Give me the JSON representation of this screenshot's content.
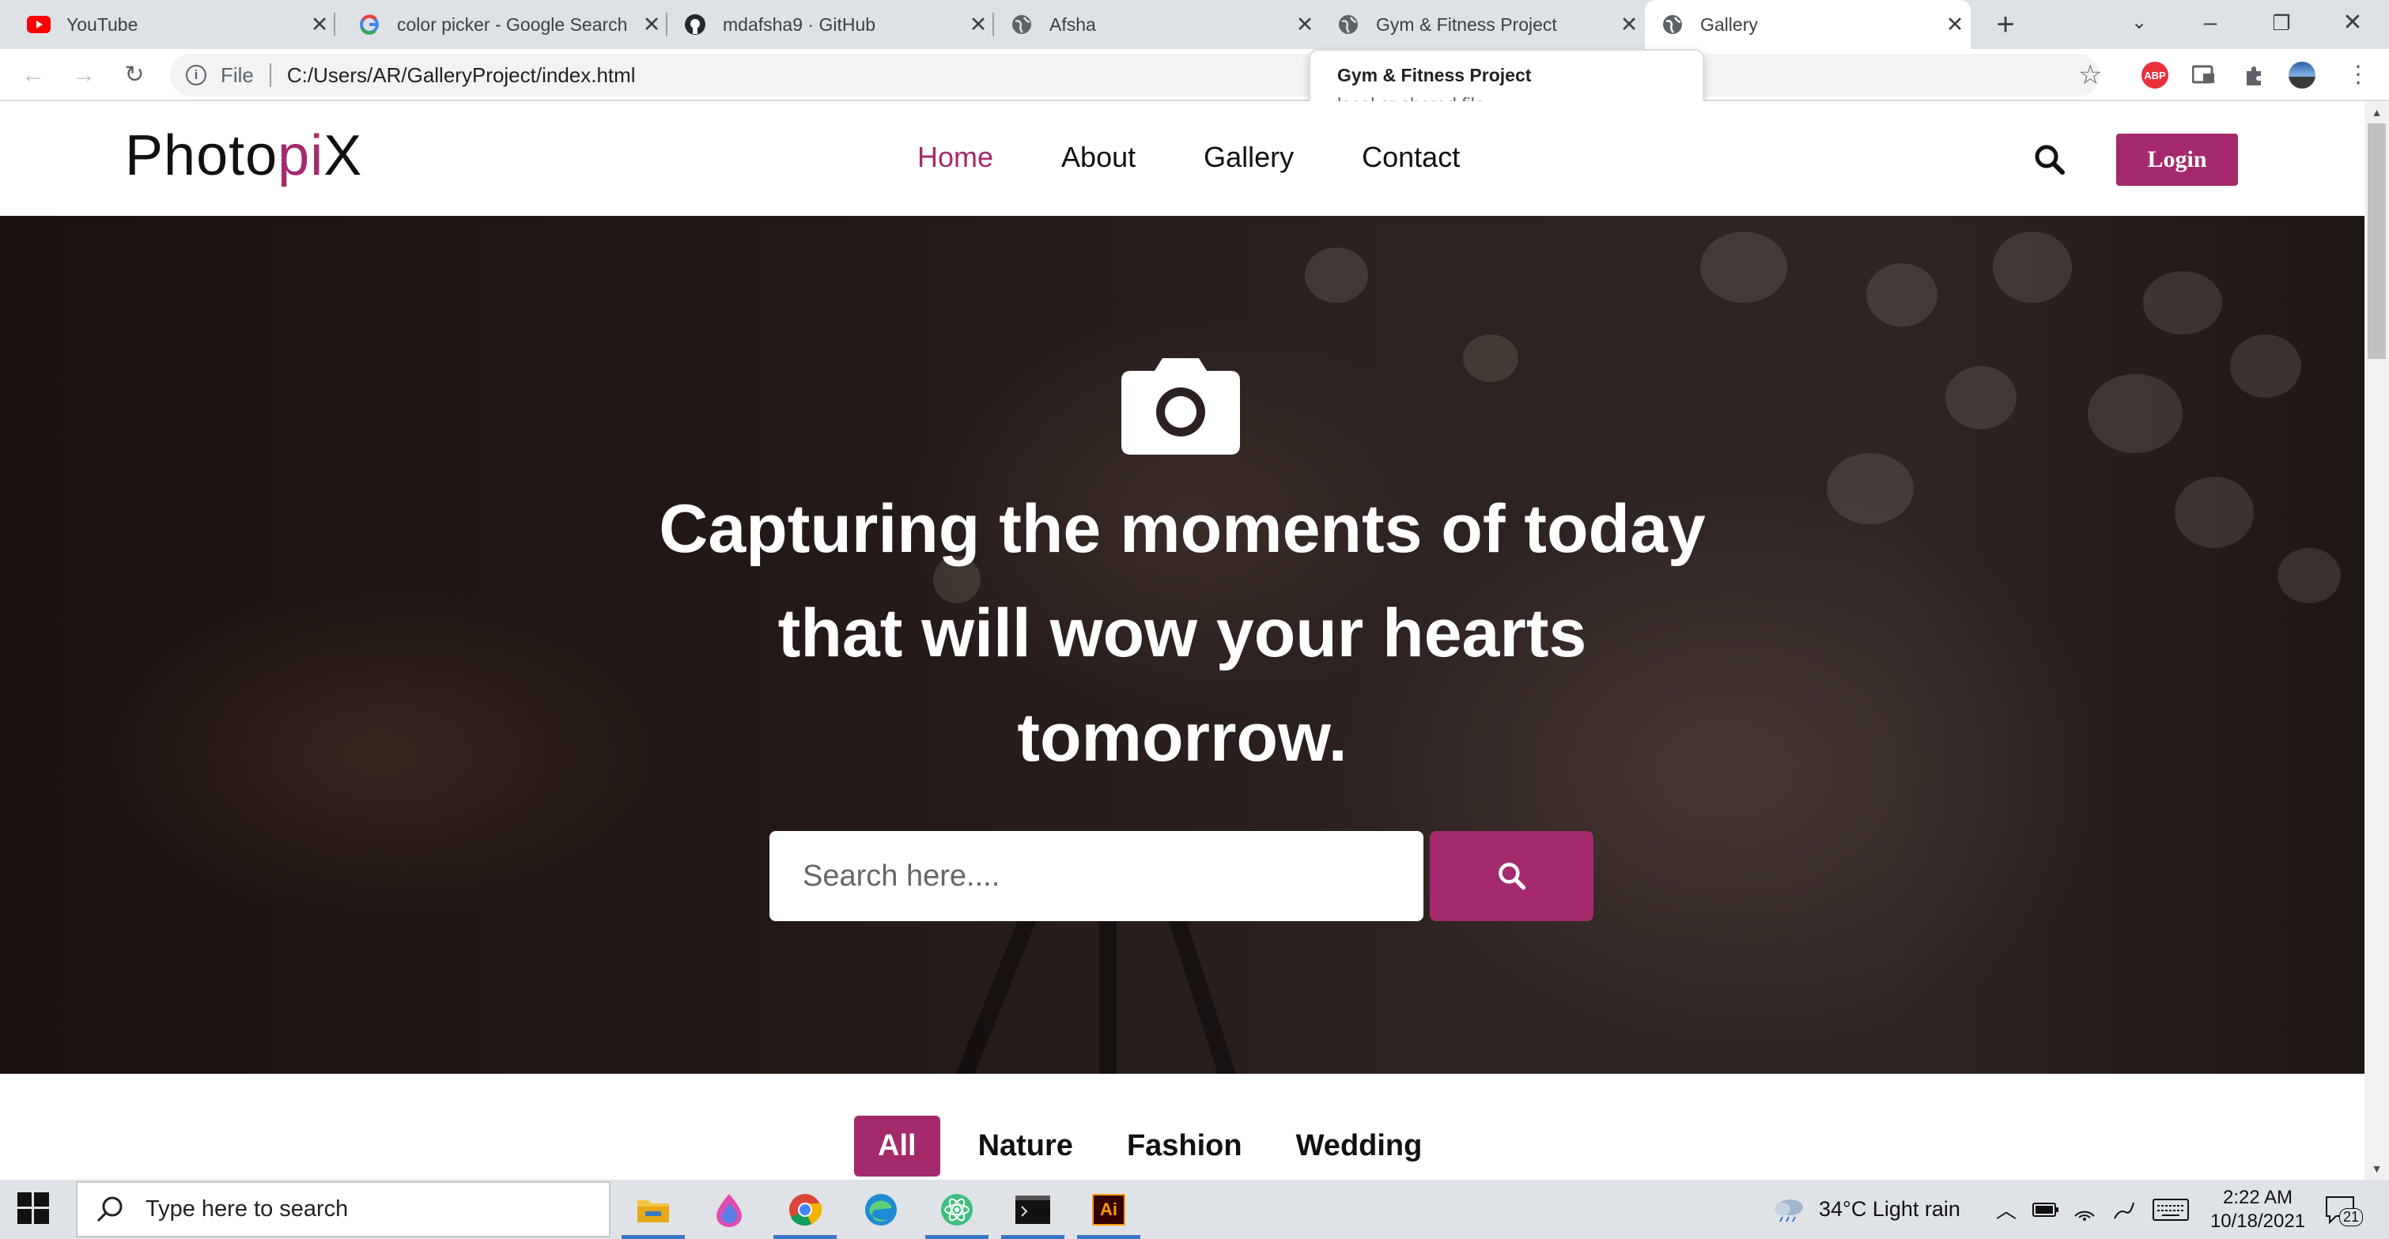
{
  "browser": {
    "tabs": [
      {
        "title": "YouTube",
        "icon": "youtube-icon"
      },
      {
        "title": "color picker - Google Search",
        "icon": "google-icon"
      },
      {
        "title": "mdafsha9 · GitHub",
        "icon": "github-icon"
      },
      {
        "title": "Afsha",
        "icon": "globe-icon"
      },
      {
        "title": "Gym & Fitness Project",
        "icon": "globe-icon"
      },
      {
        "title": "Gallery",
        "icon": "globe-icon",
        "active": true
      }
    ],
    "address": {
      "scheme_label": "File",
      "url": "C:/Users/AR/GalleryProject/index.html"
    },
    "tooltip": {
      "title": "Gym & Fitness Project",
      "subtitle": "local or shared file"
    },
    "extensions": [
      {
        "label": "ABP",
        "color": "#e8313b"
      }
    ]
  },
  "site": {
    "logo": {
      "main": "Photo",
      "accent": "pi",
      "end": "X"
    },
    "nav": [
      "Home",
      "About",
      "Gallery",
      "Contact"
    ],
    "active_nav": "Home",
    "login_label": "Login",
    "accent_color": "#a52a6c",
    "hero": {
      "icon": "camera-icon",
      "headline": "Capturing the moments of today that will wow your hearts tomorrow.",
      "search_placeholder": "Search here...."
    },
    "filters": [
      "All",
      "Nature",
      "Fashion",
      "Wedding"
    ],
    "active_filter": "All"
  },
  "taskbar": {
    "search_placeholder": "Type here to search",
    "apps": [
      "file-explorer-icon",
      "paint-icon",
      "chrome-icon",
      "edge-icon",
      "atom-icon",
      "terminal-icon",
      "illustrator-icon"
    ],
    "illustrator_label": "Ai",
    "weather": "34°C  Light rain",
    "time": "2:22 AM",
    "date": "10/18/2021",
    "notifications": "21"
  }
}
